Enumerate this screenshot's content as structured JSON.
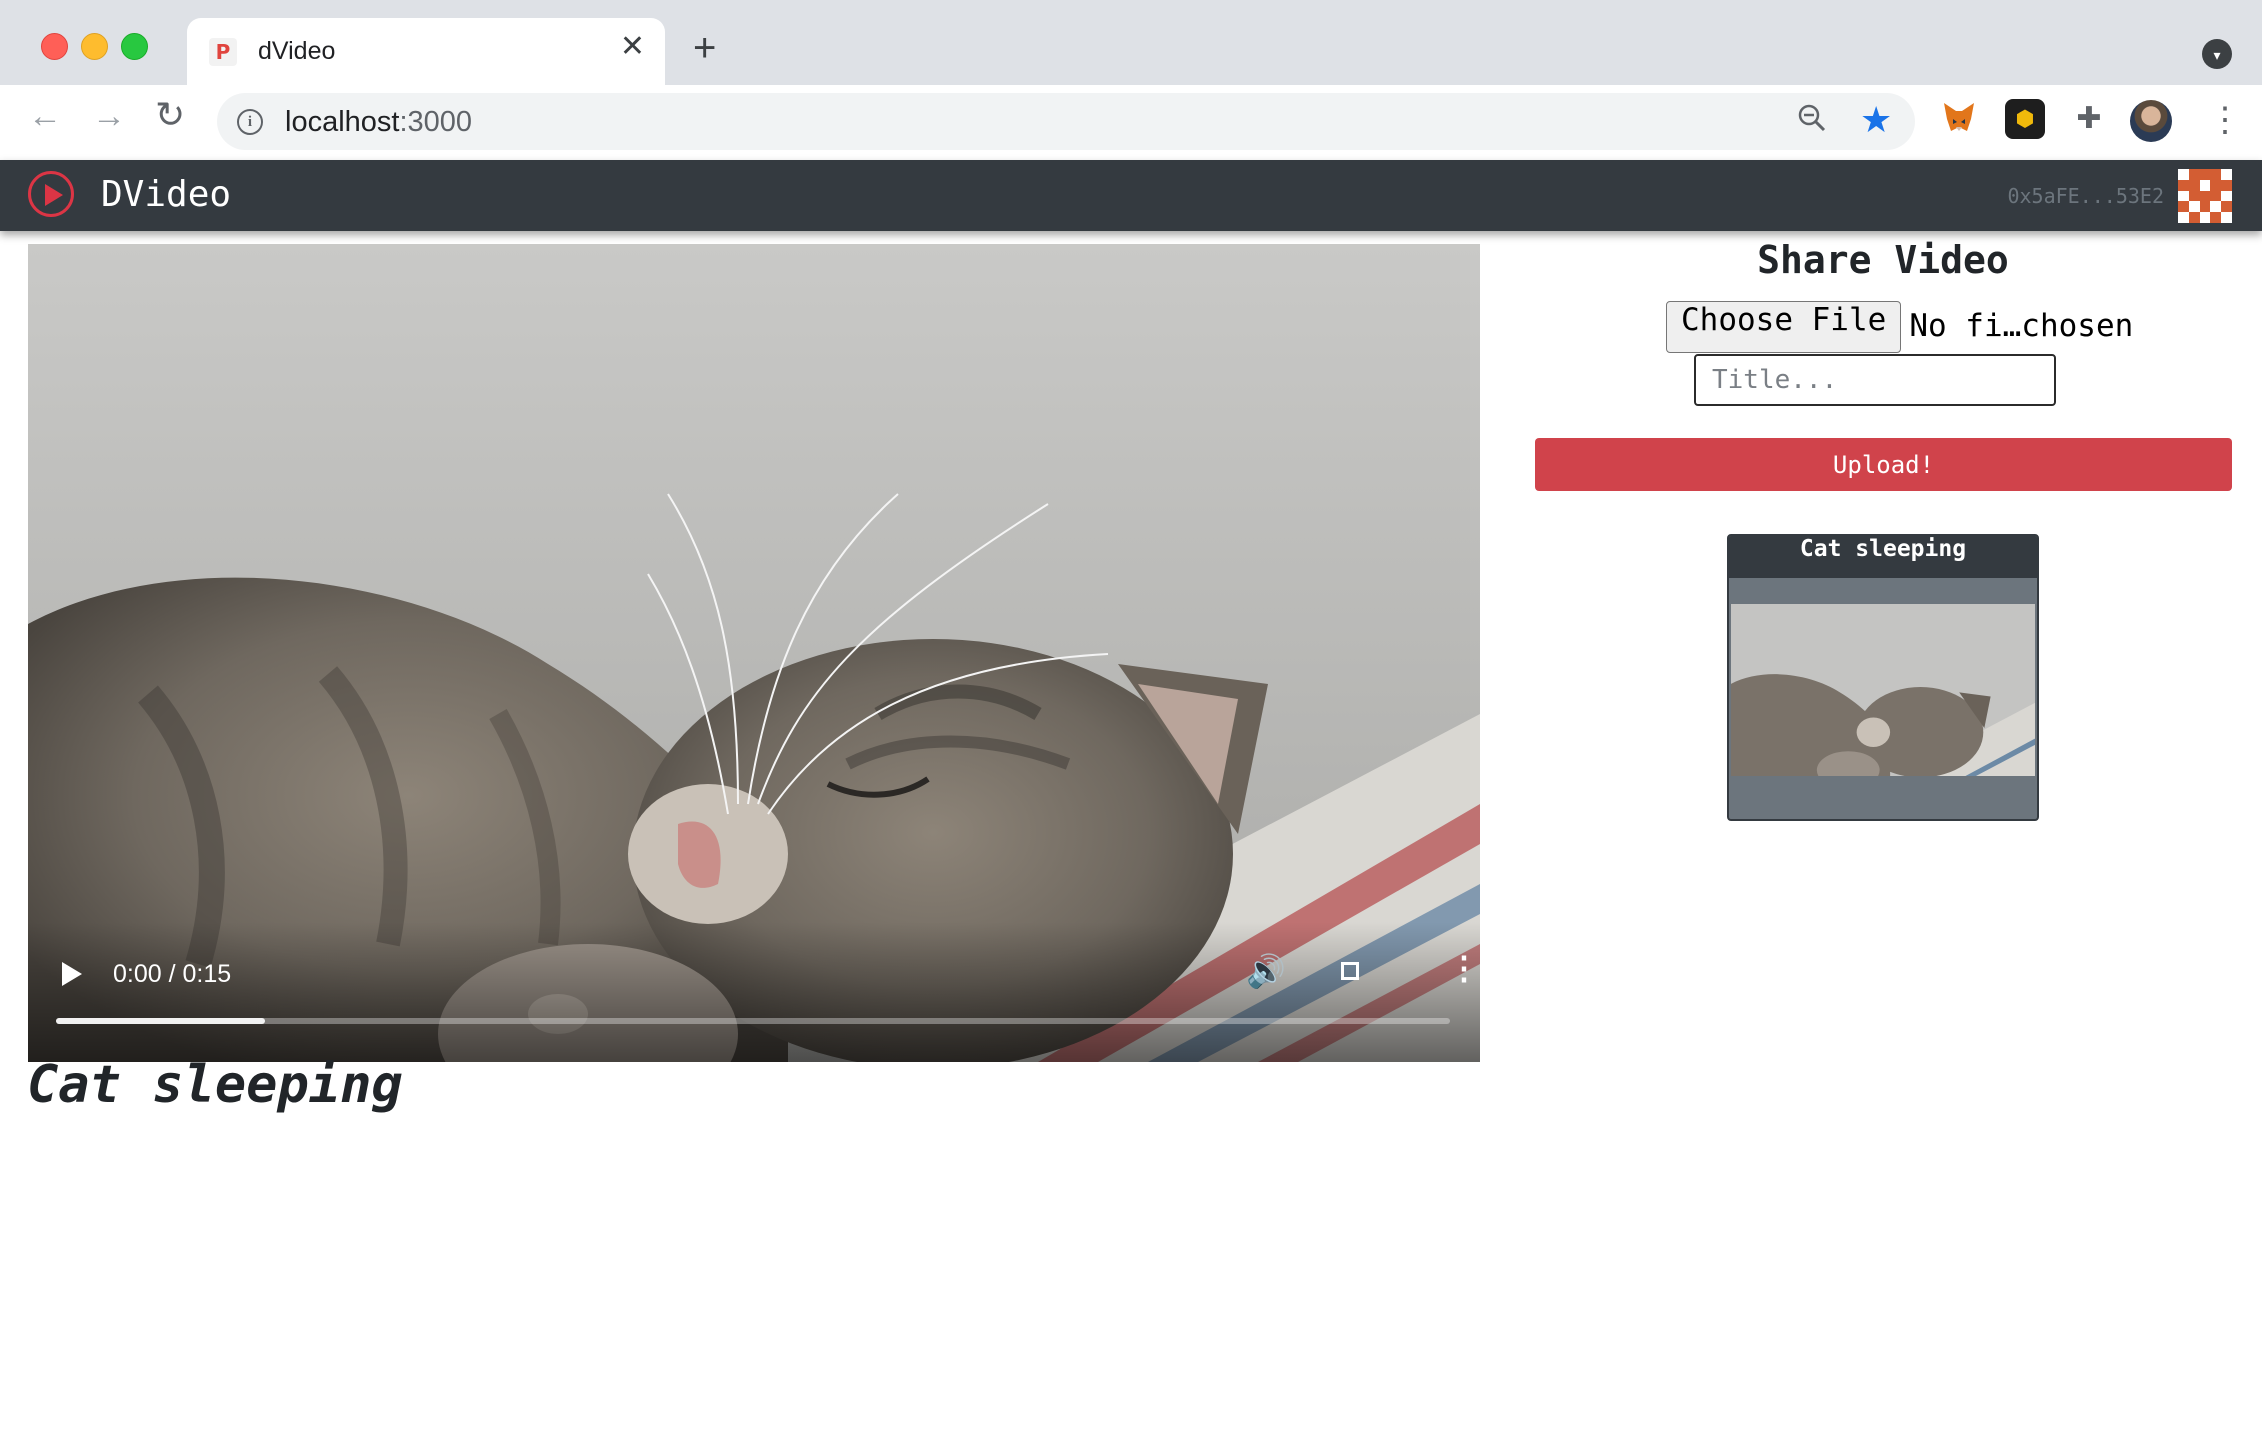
{
  "browser": {
    "tab_title": "dVideo",
    "tab_close": "✕",
    "new_tab": "+",
    "url_host": "localhost",
    "url_port": ":3000",
    "icons": [
      "back-arrow-icon",
      "forward-arrow-icon",
      "reload-icon",
      "info-icon",
      "zoom-out-icon",
      "bookmark-star-icon",
      "metamask-fox-icon",
      "binance-extension-icon",
      "extensions-puzzle-icon",
      "profile-avatar",
      "more-menu-icon",
      "profile-dropdown-icon"
    ]
  },
  "app": {
    "brand": "DVideo",
    "account": "0x5aFE...53E2"
  },
  "player": {
    "time": "0:00 / 0:15",
    "progress_fraction": 0.15,
    "caption": "Cat sleeping"
  },
  "share": {
    "heading": "Share Video",
    "choose_file": "Choose File",
    "file_status": "No fi…chosen",
    "title_placeholder": "Title...",
    "upload_label": "Upload!"
  },
  "videos": [
    {
      "title": "Cat sleeping"
    }
  ],
  "colors": {
    "navbar": "#343a40",
    "accent_red": "#dc3545",
    "upload_button": "#d0434b",
    "card_body": "#6c757d"
  }
}
